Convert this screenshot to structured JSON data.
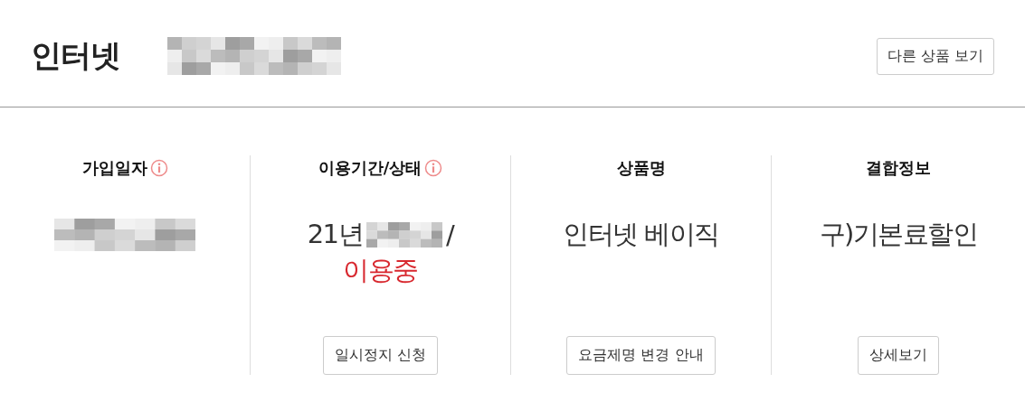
{
  "header": {
    "title": "인터넷",
    "redacted": true,
    "button": "다른 상품 보기"
  },
  "columns": [
    {
      "heading": "가입일자",
      "info": true,
      "lines": [
        [
          {
            "kind": "redacted"
          }
        ]
      ]
    },
    {
      "heading": "이용기간/상태",
      "info": true,
      "lines": [
        [
          {
            "kind": "text",
            "text": "21년"
          },
          {
            "kind": "redacted"
          },
          {
            "kind": "text",
            "text": "/"
          }
        ],
        [
          {
            "kind": "status",
            "text": "이용중"
          }
        ]
      ],
      "button": "일시정지 신청"
    },
    {
      "heading": "상품명",
      "info": false,
      "lines": [
        [
          {
            "kind": "text",
            "text": "인터넷 베이직"
          }
        ]
      ],
      "button": "요금제명 변경 안내"
    },
    {
      "heading": "결합정보",
      "info": false,
      "lines": [
        [
          {
            "kind": "text",
            "text": "구)기본료할인"
          }
        ]
      ],
      "button": "상세보기"
    }
  ]
}
